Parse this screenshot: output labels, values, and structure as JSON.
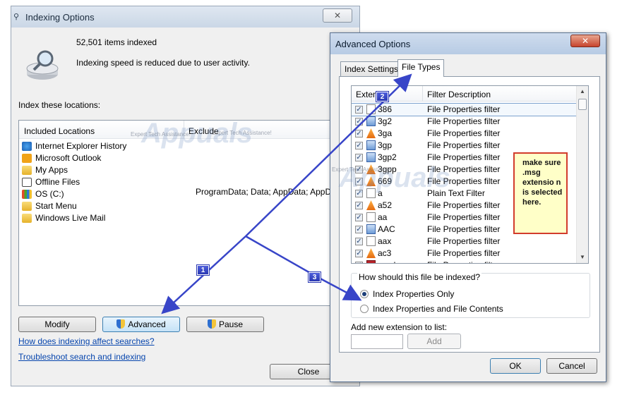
{
  "indexing": {
    "title": "Indexing Options",
    "count": "52,501 items indexed",
    "speed": "Indexing speed is reduced due to user activity.",
    "locations_title": "Index these locations:",
    "col_included": "Included Locations",
    "col_exclude": "Exclude",
    "locations": [
      "Internet Explorer History",
      "Microsoft Outlook",
      "My Apps",
      "Offline Files",
      "OS (C:)",
      "Start Menu",
      "Windows Live Mail"
    ],
    "exclude_os": "ProgramData; Data; AppData; AppData;",
    "modify": "Modify",
    "advanced": "Advanced",
    "pause": "Pause",
    "link1": "How does indexing affect searches?",
    "link2": "Troubleshoot search and indexing",
    "close": "Close"
  },
  "advanced": {
    "title": "Advanced Options",
    "close_x": "✕",
    "tab_settings": "Index Settings",
    "tab_filetypes": "File Types",
    "col_ext": "Extens",
    "col_desc": "Filter Description",
    "rows": [
      {
        "ext": "386",
        "desc": "File Properties filter"
      },
      {
        "ext": "3g2",
        "desc": "File Properties filter"
      },
      {
        "ext": "3ga",
        "desc": "File Properties filter"
      },
      {
        "ext": "3gp",
        "desc": "File Properties filter"
      },
      {
        "ext": "3gp2",
        "desc": "File Properties filter"
      },
      {
        "ext": "3gpp",
        "desc": "File Properties filter"
      },
      {
        "ext": "669",
        "desc": "File Properties filter"
      },
      {
        "ext": "a",
        "desc": "Plain Text Filter"
      },
      {
        "ext": "a52",
        "desc": "File Properties filter"
      },
      {
        "ext": "aa",
        "desc": "File Properties filter"
      },
      {
        "ext": "AAC",
        "desc": "File Properties filter"
      },
      {
        "ext": "aax",
        "desc": "File Properties filter"
      },
      {
        "ext": "ac3",
        "desc": "File Properties filter"
      },
      {
        "ext": "accda",
        "desc": "File Properties filter"
      }
    ],
    "how_question": "How should this file be indexed?",
    "opt_props": "Index Properties Only",
    "opt_contents": "Index Properties and File Contents",
    "add_label": "Add new extension to list:",
    "add_button": "Add",
    "ok": "OK",
    "cancel": "Cancel"
  },
  "annotation": {
    "note": "make sure .msg extensio n is selected here.",
    "step1": "1",
    "step2": "2",
    "step3": "3"
  },
  "watermark": {
    "brand": "Appuals",
    "tagline": "Expert Tech Assistance!"
  }
}
